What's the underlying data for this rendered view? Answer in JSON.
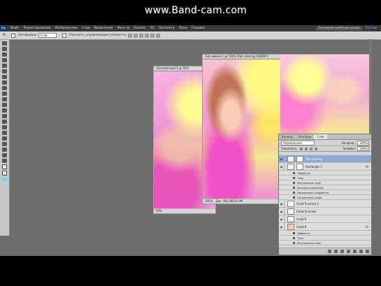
{
  "watermark": "www.Band-cam.com",
  "menubar": {
    "logo": "Ps",
    "items": [
      "Файл",
      "Редактирование",
      "Изображение",
      "Слои",
      "Выделение",
      "Фильтр",
      "Анализ",
      "3D",
      "Просмотр",
      "Окно",
      "Справка"
    ],
    "workspace": "Основная рабочая среда",
    "cs_live": "CS Live"
  },
  "options": {
    "tool_label": "Ф",
    "mode_label": "Автовыбор:",
    "mode_value": "Слой",
    "transform_label": "Показать управляющие элементы"
  },
  "doc1": {
    "title": "Безымянный-1 @ 50%",
    "zoom": "50%"
  },
  "doc2": {
    "title": "Без имени-1 @ 100% (Fall coloring, RGB/8*)",
    "zoom": "100%",
    "docsize": "Док: 901,8K/14,6M"
  },
  "layers_panel": {
    "tabs": [
      "Каналы",
      "Контуры",
      "Слои"
    ],
    "active_tab": "Слои",
    "blend_mode": "Нормальный",
    "opacity_label": "Непрозр.:",
    "opacity": "100%",
    "lock_label": "Закрепить:",
    "fill_label": "Заливка:",
    "fill": "100%",
    "layers": [
      {
        "name": "Fall coloring",
        "type": "adjust",
        "selected": true,
        "fx": false
      },
      {
        "name": "Rectangle 1",
        "type": "shape",
        "selected": false,
        "fx": true
      },
      {
        "name": "Эффекты",
        "type": "sub"
      },
      {
        "name": "Тень",
        "type": "sub"
      },
      {
        "name": "Внутренняя тень",
        "type": "sub"
      },
      {
        "name": "Внешнее свечение",
        "type": "sub"
      },
      {
        "name": "Наложение градиента",
        "type": "sub"
      },
      {
        "name": "Наложение узора",
        "type": "sub"
      },
      {
        "name": "Слой 9 копия 2",
        "type": "pixel",
        "selected": false,
        "fx": false
      },
      {
        "name": "Слой 9 копия",
        "type": "pixel",
        "selected": false,
        "fx": false
      },
      {
        "name": "Слой 9",
        "type": "pixel",
        "selected": false,
        "fx": false
      },
      {
        "name": "Слой 8",
        "type": "pic",
        "selected": false,
        "fx": true
      },
      {
        "name": "Эффекты",
        "type": "sub"
      },
      {
        "name": "Тень",
        "type": "sub"
      },
      {
        "name": "Внутренняя тень",
        "type": "sub"
      }
    ]
  }
}
